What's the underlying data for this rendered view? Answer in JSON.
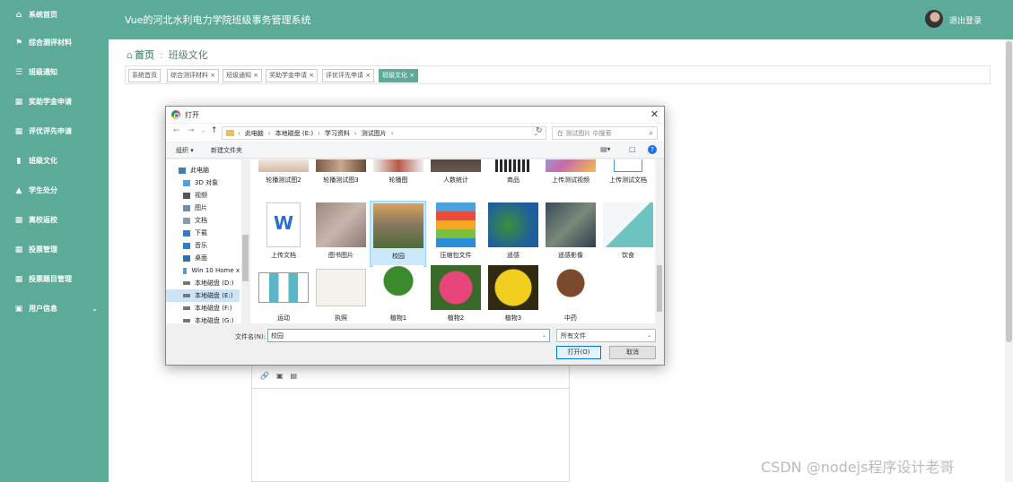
{
  "sidebar": {
    "items": [
      {
        "label": "系统首页",
        "icon": "home-icon"
      },
      {
        "label": "综合测评材料",
        "icon": "flag-icon"
      },
      {
        "label": "班级通知",
        "icon": "list-icon"
      },
      {
        "label": "奖助学金申请",
        "icon": "grid-icon"
      },
      {
        "label": "评优评先申请",
        "icon": "grid-icon"
      },
      {
        "label": "班级文化",
        "icon": "bar-chart-icon"
      },
      {
        "label": "学生处分",
        "icon": "hat-icon"
      },
      {
        "label": "离校返校",
        "icon": "grid-icon"
      },
      {
        "label": "投票管理",
        "icon": "grid-icon"
      },
      {
        "label": "投票题目管理",
        "icon": "grid-icon"
      },
      {
        "label": "用户信息",
        "icon": "calendar-icon"
      }
    ]
  },
  "header": {
    "title": "Vue的河北水利电力学院班级事务管理系统",
    "logout": "退出登录"
  },
  "breadcrumb": {
    "home": "首页",
    "current": "班级文化"
  },
  "tags": [
    "系统首页",
    "综合测评材料 ×",
    "班级通知 ×",
    "奖助学金申请 ×",
    "评优评先申请 ×",
    "班级文化 ×"
  ],
  "dialog": {
    "title": "打开",
    "path": [
      "此电脑",
      "本地磁盘 (E:)",
      "学习资料",
      "测试图片"
    ],
    "search_placeholder": "在 测试图片 中搜索",
    "organize": "组织 ▾",
    "new_folder": "新建文件夹",
    "nav": [
      "此电脑",
      "3D 对象",
      "视频",
      "图片",
      "文档",
      "下载",
      "音乐",
      "桌面",
      "Win 10 Home x",
      "本地磁盘 (D:)",
      "本地磁盘 (E:)",
      "本地磁盘 (F:)",
      "本地磁盘 (G:)"
    ],
    "files": [
      {
        "name": "轮播测试图2"
      },
      {
        "name": "轮播测试图3"
      },
      {
        "name": "轮播图"
      },
      {
        "name": "人数统计"
      },
      {
        "name": "商品"
      },
      {
        "name": "上传测试视频"
      },
      {
        "name": "上传测试文档"
      },
      {
        "name": "上传文档"
      },
      {
        "name": "图书图片"
      },
      {
        "name": "校园"
      },
      {
        "name": "压缩包文件"
      },
      {
        "name": "遥感"
      },
      {
        "name": "遥感影像"
      },
      {
        "name": "饮食"
      },
      {
        "name": "运动"
      },
      {
        "name": "执照"
      },
      {
        "name": "植物1"
      },
      {
        "name": "植物2"
      },
      {
        "name": "植物3"
      },
      {
        "name": "中药"
      }
    ],
    "filename_label": "文件名(N):",
    "filename_value": "校园",
    "filetype": "所有文件",
    "open_label": "打开(O)",
    "cancel_label": "取消"
  },
  "watermark": "CSDN @nodejs程序设计老哥"
}
